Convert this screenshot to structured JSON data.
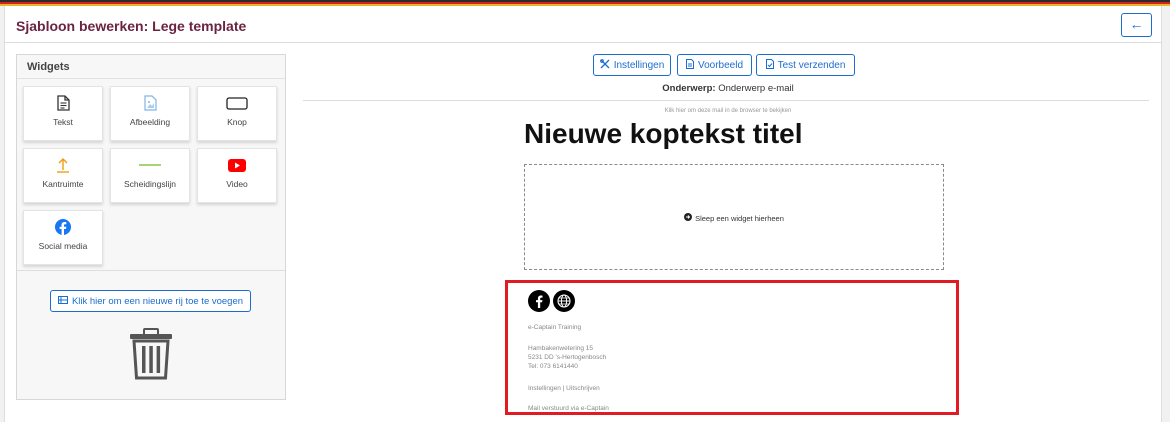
{
  "header": {
    "title": "Sjabloon bewerken: Lege template",
    "back_icon": "arrow-left-icon"
  },
  "widgets": {
    "title": "Widgets",
    "items": [
      {
        "label": "Tekst",
        "icon": "document-icon"
      },
      {
        "label": "Afbeelding",
        "icon": "image-icon"
      },
      {
        "label": "Knop",
        "icon": "button-icon"
      },
      {
        "label": "Kantruimte",
        "icon": "spacer-icon"
      },
      {
        "label": "Scheidingslijn",
        "icon": "divider-icon"
      },
      {
        "label": "Video",
        "icon": "youtube-icon"
      },
      {
        "label": "Social media",
        "icon": "facebook-icon"
      }
    ],
    "add_row_label": "Klik hier om een nieuwe rij toe te voegen",
    "trash_icon": "trash-icon"
  },
  "toolbar": {
    "settings_label": "Instellingen",
    "preview_label": "Voorbeeld",
    "test_label": "Test verzenden"
  },
  "email": {
    "subject_label": "Onderwerp:",
    "subject_value": "Onderwerp e-mail",
    "browser_link": "Klik hier om deze mail in de browser te bekijken",
    "heading": "Nieuwe koptekst titel",
    "drop_hint": "Sleep een widget hierheen"
  },
  "footer": {
    "social_icons": [
      "facebook-icon",
      "globe-icon"
    ],
    "company": "e-Captain Training",
    "address_line1": "Hambakenwetering 15",
    "address_line2": "5231 DD 's-Hertogenbosch",
    "phone": "Tel: 073 6141440",
    "links": "Instellingen | Uitschrijven",
    "sent_via": "Mail verstuurd via e-Captain"
  },
  "colors": {
    "title": "#6b2440",
    "accent": "#1c6dd0",
    "highlight": "#e11b22",
    "youtube": "#ff0000",
    "facebook": "#1877f2",
    "spacer": "#f39c12",
    "divider": "#8bc34a"
  }
}
